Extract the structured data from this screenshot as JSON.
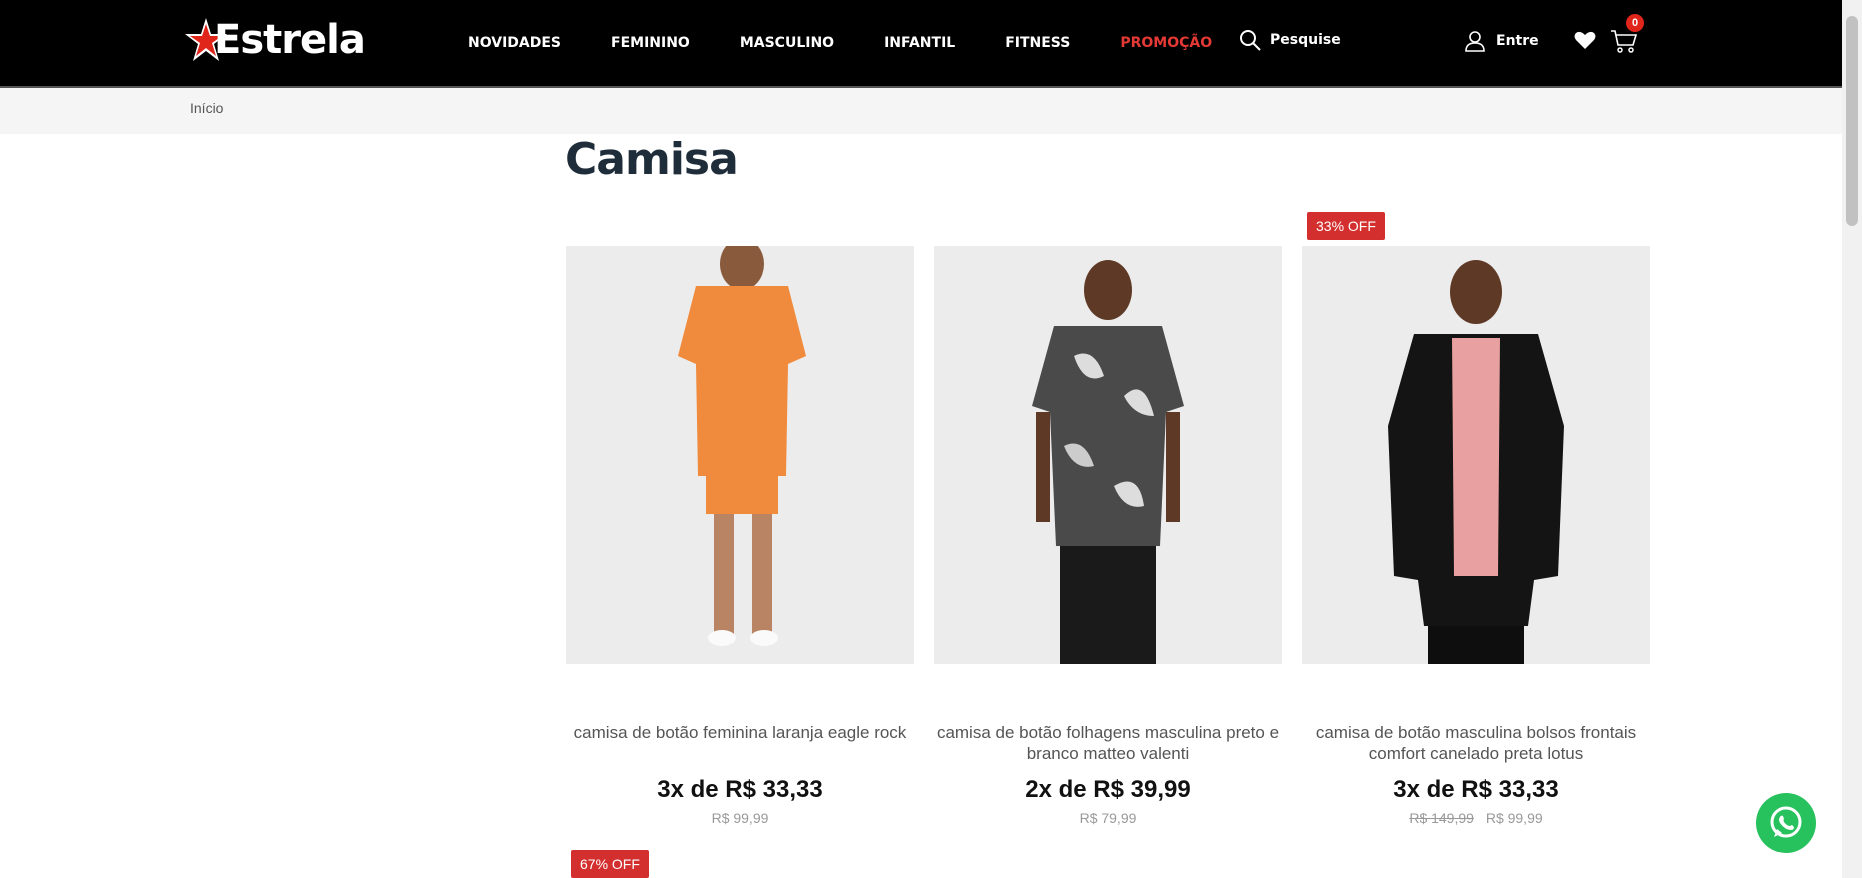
{
  "header": {
    "logo_text": "Estrela",
    "nav": [
      "NOVIDADES",
      "FEMININO",
      "MASCULINO",
      "INFANTIL",
      "FITNESS",
      "PROMOÇÃO"
    ],
    "search_label": "Pesquise",
    "account_label": "Entre",
    "cart_count": "0"
  },
  "breadcrumb": "Início",
  "page_title": "Camisa",
  "products": [
    {
      "name": "camisa de botão feminina laranja eagle rock",
      "installment": "3x de R$ 33,33",
      "price": "R$ 99,99"
    },
    {
      "name": "camisa de botão folhagens masculina preto e branco matteo valenti",
      "installment": "2x de R$ 39,99",
      "price": "R$ 79,99"
    },
    {
      "badge": "33% OFF",
      "name": "camisa de botão masculina bolsos frontais comfort canelado preta lotus",
      "installment": "3x de R$ 33,33",
      "old_price": "R$ 149,99",
      "price": "R$ 99,99"
    },
    {
      "badge": "67% OFF"
    }
  ],
  "colors": {
    "header_bg": "#000000",
    "promo": "#e53935",
    "badge": "#d32f2f",
    "whatsapp": "#27c15d"
  }
}
